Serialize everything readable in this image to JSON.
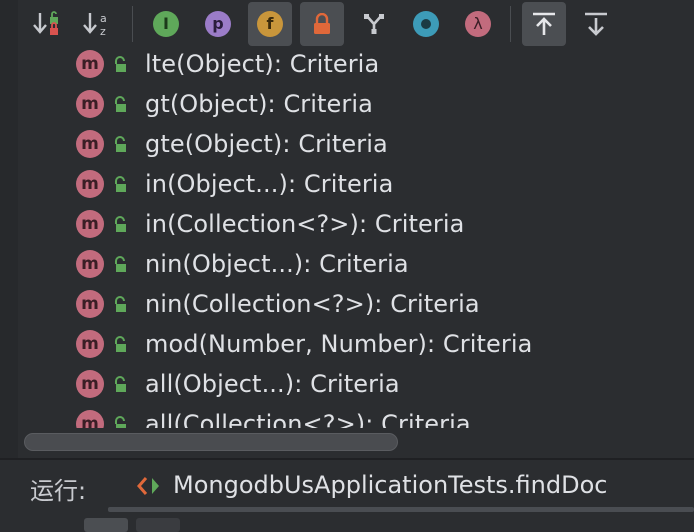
{
  "toolbar": {
    "buttons": [
      {
        "name": "sort-by-visibility",
        "icon": "sort-visibility-icon"
      },
      {
        "name": "sort-alphabetically",
        "icon": "sort-alpha-icon",
        "glyph": "az"
      },
      {
        "name": "show-inherited",
        "icon": "inherited-icon",
        "glyph": "I"
      },
      {
        "name": "show-properties",
        "icon": "property-icon",
        "glyph": "p"
      },
      {
        "name": "show-fields",
        "icon": "field-icon",
        "glyph": "f",
        "active": true
      },
      {
        "name": "show-non-public",
        "icon": "lock-icon",
        "active": true
      },
      {
        "name": "show-anonymous",
        "icon": "anonymous-icon"
      },
      {
        "name": "show-lambdas",
        "icon": "circle-icon"
      },
      {
        "name": "show-lambda",
        "icon": "lambda-icon",
        "glyph": "λ"
      },
      {
        "name": "expand-all",
        "icon": "expand-icon",
        "active": true
      },
      {
        "name": "collapse-all",
        "icon": "collapse-icon"
      }
    ]
  },
  "colors": {
    "background": "#2b2d30",
    "method_icon": "#c26b7d",
    "lock_green": "#5fa85a",
    "field_icon": "#c9963b",
    "property_icon": "#9b7cc8",
    "inherited_icon": "#5fa85a",
    "lambda_icon": "#c26b7d",
    "circle_icon": "#3d9bb8"
  },
  "members": [
    {
      "badge": "m",
      "label": "lte(Object): Criteria"
    },
    {
      "badge": "m",
      "label": "gt(Object): Criteria"
    },
    {
      "badge": "m",
      "label": "gte(Object): Criteria"
    },
    {
      "badge": "m",
      "label": "in(Object...): Criteria"
    },
    {
      "badge": "m",
      "label": "in(Collection<?>): Criteria"
    },
    {
      "badge": "m",
      "label": "nin(Object...): Criteria"
    },
    {
      "badge": "m",
      "label": "nin(Collection<?>): Criteria"
    },
    {
      "badge": "m",
      "label": "mod(Number, Number): Criteria"
    },
    {
      "badge": "m",
      "label": "all(Object...): Criteria"
    },
    {
      "badge": "m",
      "label": "all(Collection<?>): Criteria"
    }
  ],
  "run": {
    "label": "运行:",
    "config": "MongodbUsApplicationTests.findDoc"
  }
}
